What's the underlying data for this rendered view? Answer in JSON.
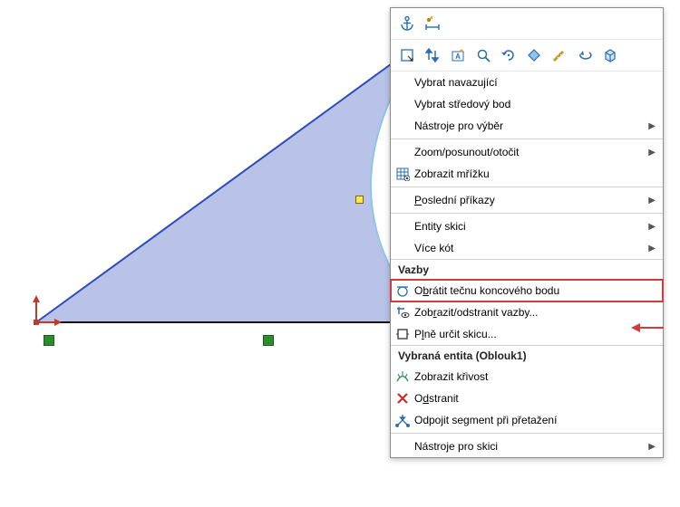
{
  "canvas": {
    "shape_description": "filled closed profile between two lines and one concave arc",
    "origin_marker": "sketch-origin",
    "constraints": [
      "horizontal-constraint",
      "horizontal-constraint"
    ],
    "handle": "selected-endpoint"
  },
  "toolbar_row1": {
    "items": [
      {
        "name": "anchor-icon",
        "svg": "anchor"
      },
      {
        "name": "smart-dimension-icon",
        "svg": "dim"
      }
    ]
  },
  "toolbar_row2": {
    "items": [
      {
        "name": "select-box-icon",
        "svg": "selbox"
      },
      {
        "name": "sort-icon",
        "svg": "sort"
      },
      {
        "name": "note-icon",
        "svg": "note"
      },
      {
        "name": "zoom-icon",
        "svg": "zoom"
      },
      {
        "name": "rotate-icon",
        "svg": "rotate"
      },
      {
        "name": "rhombus-icon",
        "svg": "rhomb"
      },
      {
        "name": "measure-icon",
        "svg": "meas"
      },
      {
        "name": "undo-icon",
        "svg": "undo"
      },
      {
        "name": "box3d-icon",
        "svg": "box3d"
      }
    ]
  },
  "menu": {
    "items": [
      {
        "label": "Vybrat navazující",
        "icon": "",
        "sub": false,
        "ul": null
      },
      {
        "label": "Vybrat středový bod",
        "icon": "",
        "sub": false,
        "ul": null
      },
      {
        "label": "Nástroje pro výběr",
        "icon": "",
        "sub": true,
        "ul": null
      },
      "sep",
      {
        "label": "Zoom/posunout/otočit",
        "icon": "",
        "sub": true,
        "ul": null
      },
      {
        "label": "Zobrazit mřížku",
        "icon": "grid",
        "sub": false,
        "ul": null
      },
      "sep",
      {
        "label": "Poslední příkazy",
        "icon": "",
        "sub": true,
        "ul": "P"
      },
      "sep",
      {
        "label": "Entity skici",
        "icon": "",
        "sub": true,
        "ul": null
      },
      {
        "label": "Více kót",
        "icon": "",
        "sub": true,
        "ul": null
      }
    ],
    "header_relations": "Vazby",
    "relations": [
      {
        "label": "Obrátit tečnu koncového bodu",
        "icon": "tangent",
        "ul": "b",
        "highlight": true
      },
      {
        "label": "Zobrazit/odstranit vazby...",
        "icon": "eye",
        "ul": "r"
      },
      {
        "label": "Plně určit skicu...",
        "icon": "define",
        "ul": "l"
      }
    ],
    "header_entity": "Vybraná entita (Oblouk1)",
    "entity_items": [
      {
        "label": "Zobrazit křivost",
        "icon": "curvature",
        "ul": null
      },
      {
        "label": "Odstranit",
        "icon": "delete",
        "ul": "d"
      },
      {
        "label": "Odpojit segment při přetažení",
        "icon": "detach",
        "ul": null
      }
    ],
    "footer": [
      {
        "label": "Nástroje pro skici",
        "icon": "",
        "sub": true
      }
    ]
  }
}
